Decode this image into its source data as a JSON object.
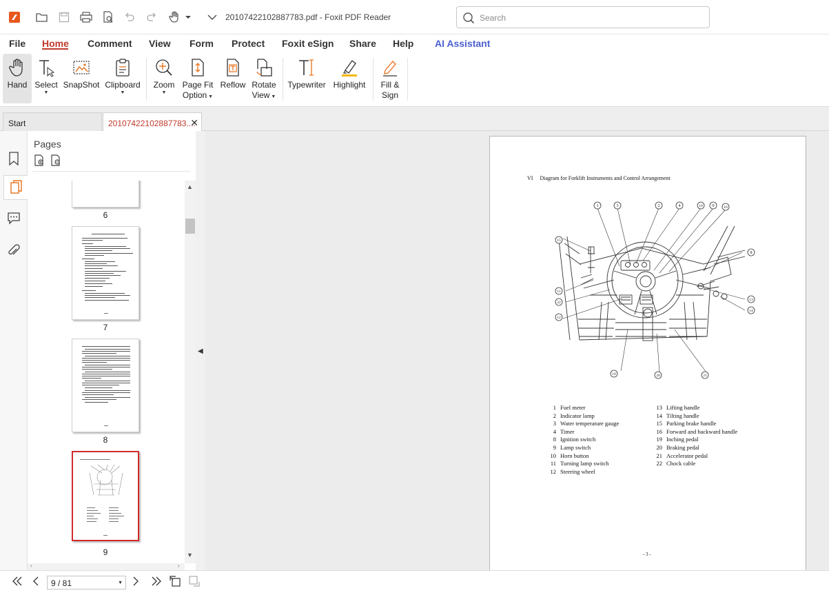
{
  "window": {
    "title": "20107422102887783.pdf - Foxit PDF Reader"
  },
  "search": {
    "placeholder": "Search"
  },
  "quick_access": [
    "app-logo-icon",
    "open-folder-icon",
    "save-icon",
    "print-icon",
    "page-preview-icon",
    "undo-icon",
    "redo-icon",
    "hand-tool-icon",
    "customize-dropdown-icon"
  ],
  "menu": [
    "File",
    "Home",
    "Comment",
    "View",
    "Form",
    "Protect",
    "Foxit eSign",
    "Share",
    "Help",
    "AI Assistant"
  ],
  "menu_active": "Home",
  "ribbon": {
    "hand": "Hand",
    "select": "Select",
    "snapshot": "SnapShot",
    "clipboard": "Clipboard",
    "zoom": "Zoom",
    "pagefit_1": "Page Fit",
    "pagefit_2": "Option",
    "reflow": "Reflow",
    "rotate_1": "Rotate",
    "rotate_2": "View",
    "typewriter": "Typewriter",
    "highlight": "Highlight",
    "fill_1": "Fill &",
    "fill_2": "Sign"
  },
  "tabs": {
    "start": "Start",
    "doc": "20107422102887783....",
    "close": "✕"
  },
  "pages_panel": {
    "title": "Pages",
    "thumbs": [
      {
        "label": "6"
      },
      {
        "label": "7"
      },
      {
        "label": "8"
      },
      {
        "label": "9",
        "selected": true
      }
    ]
  },
  "document": {
    "heading_num": "VI",
    "heading": "Diagram for Forklift Instruments and Control Arrangement",
    "callouts": [
      "1",
      "3",
      "2",
      "4",
      "10",
      "9",
      "16",
      "15",
      "8",
      "11",
      "22",
      "12",
      "13",
      "14",
      "19",
      "20",
      "21"
    ],
    "legend_left": [
      {
        "n": "1",
        "t": "Fuel meter"
      },
      {
        "n": "2",
        "t": "Indicator lamp"
      },
      {
        "n": "3",
        "t": "Water temperature gauge"
      },
      {
        "n": "4",
        "t": "Timer"
      },
      {
        "n": "8",
        "t": "Ignition switch"
      },
      {
        "n": "9",
        "t": "Lamp switch"
      },
      {
        "n": "10",
        "t": "Horn button"
      },
      {
        "n": "11",
        "t": "Turning lamp switch"
      },
      {
        "n": "12",
        "t": "Steering wheel"
      }
    ],
    "legend_right": [
      {
        "n": "13",
        "t": "Lifting handle"
      },
      {
        "n": "14",
        "t": "Tilting handle"
      },
      {
        "n": "15",
        "t": "Parking brake handle"
      },
      {
        "n": "16",
        "t": "Forward and backward handle"
      },
      {
        "n": "19",
        "t": "Inching pedal"
      },
      {
        "n": "20",
        "t": "Braking pedal"
      },
      {
        "n": "21",
        "t": "Accelerator pedal"
      },
      {
        "n": "22",
        "t": "Chock cable"
      }
    ],
    "footer": "- 3 -"
  },
  "bottom": {
    "page_indicator": "9 / 81"
  }
}
